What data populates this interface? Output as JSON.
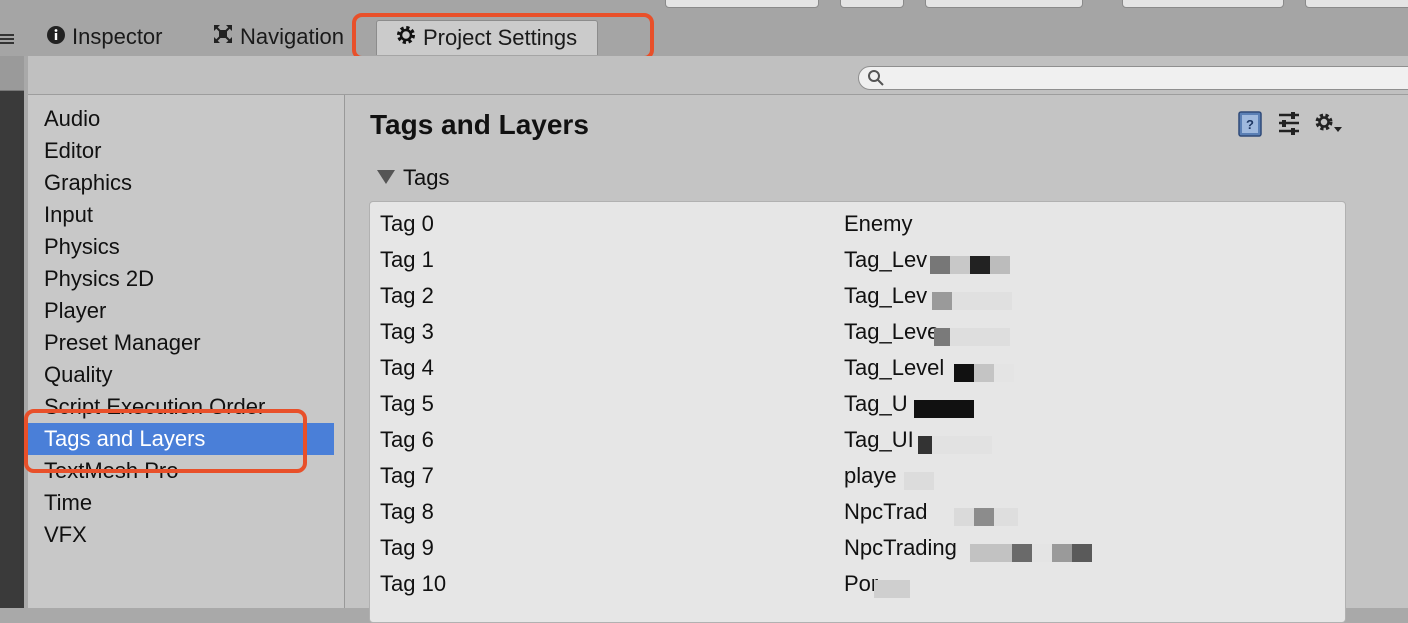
{
  "tabs": [
    {
      "label": "Inspector",
      "icon": "info-icon"
    },
    {
      "label": "Navigation",
      "icon": "navigation-icon"
    },
    {
      "label": "Project Settings",
      "icon": "gear-icon"
    }
  ],
  "search": {
    "value": ""
  },
  "sidebar": {
    "items": [
      {
        "label": "Audio"
      },
      {
        "label": "Editor"
      },
      {
        "label": "Graphics"
      },
      {
        "label": "Input"
      },
      {
        "label": "Physics"
      },
      {
        "label": "Physics 2D"
      },
      {
        "label": "Player"
      },
      {
        "label": "Preset Manager"
      },
      {
        "label": "Quality"
      },
      {
        "label": "Script Execution Order"
      },
      {
        "label": "Tags and Layers"
      },
      {
        "label": "TextMesh Pro"
      },
      {
        "label": "Time"
      },
      {
        "label": "VFX"
      }
    ],
    "selected": "Tags and Layers"
  },
  "content": {
    "title": "Tags and Layers",
    "header_icons": [
      "help-book-icon",
      "presets-icon",
      "settings-gear-icon"
    ],
    "section": "Tags",
    "tags": [
      {
        "label": "Tag 0",
        "value": "Enemy"
      },
      {
        "label": "Tag 1",
        "value": "Tag_Lev"
      },
      {
        "label": "Tag 2",
        "value": "Tag_Lev"
      },
      {
        "label": "Tag 3",
        "value": "Tag_Leve"
      },
      {
        "label": "Tag 4",
        "value": "Tag_Level"
      },
      {
        "label": "Tag 5",
        "value": "Tag_U"
      },
      {
        "label": "Tag 6",
        "value": "Tag_UI"
      },
      {
        "label": "Tag 7",
        "value": "playe"
      },
      {
        "label": "Tag 8",
        "value": "NpcTrad"
      },
      {
        "label": "Tag 9",
        "value": "NpcTrading"
      },
      {
        "label": "Tag 10",
        "value": "Por"
      }
    ]
  },
  "colors": {
    "selection": "#4a7fd8",
    "highlight_box": "#e8502a",
    "panel_bg": "#c4c4c4"
  }
}
